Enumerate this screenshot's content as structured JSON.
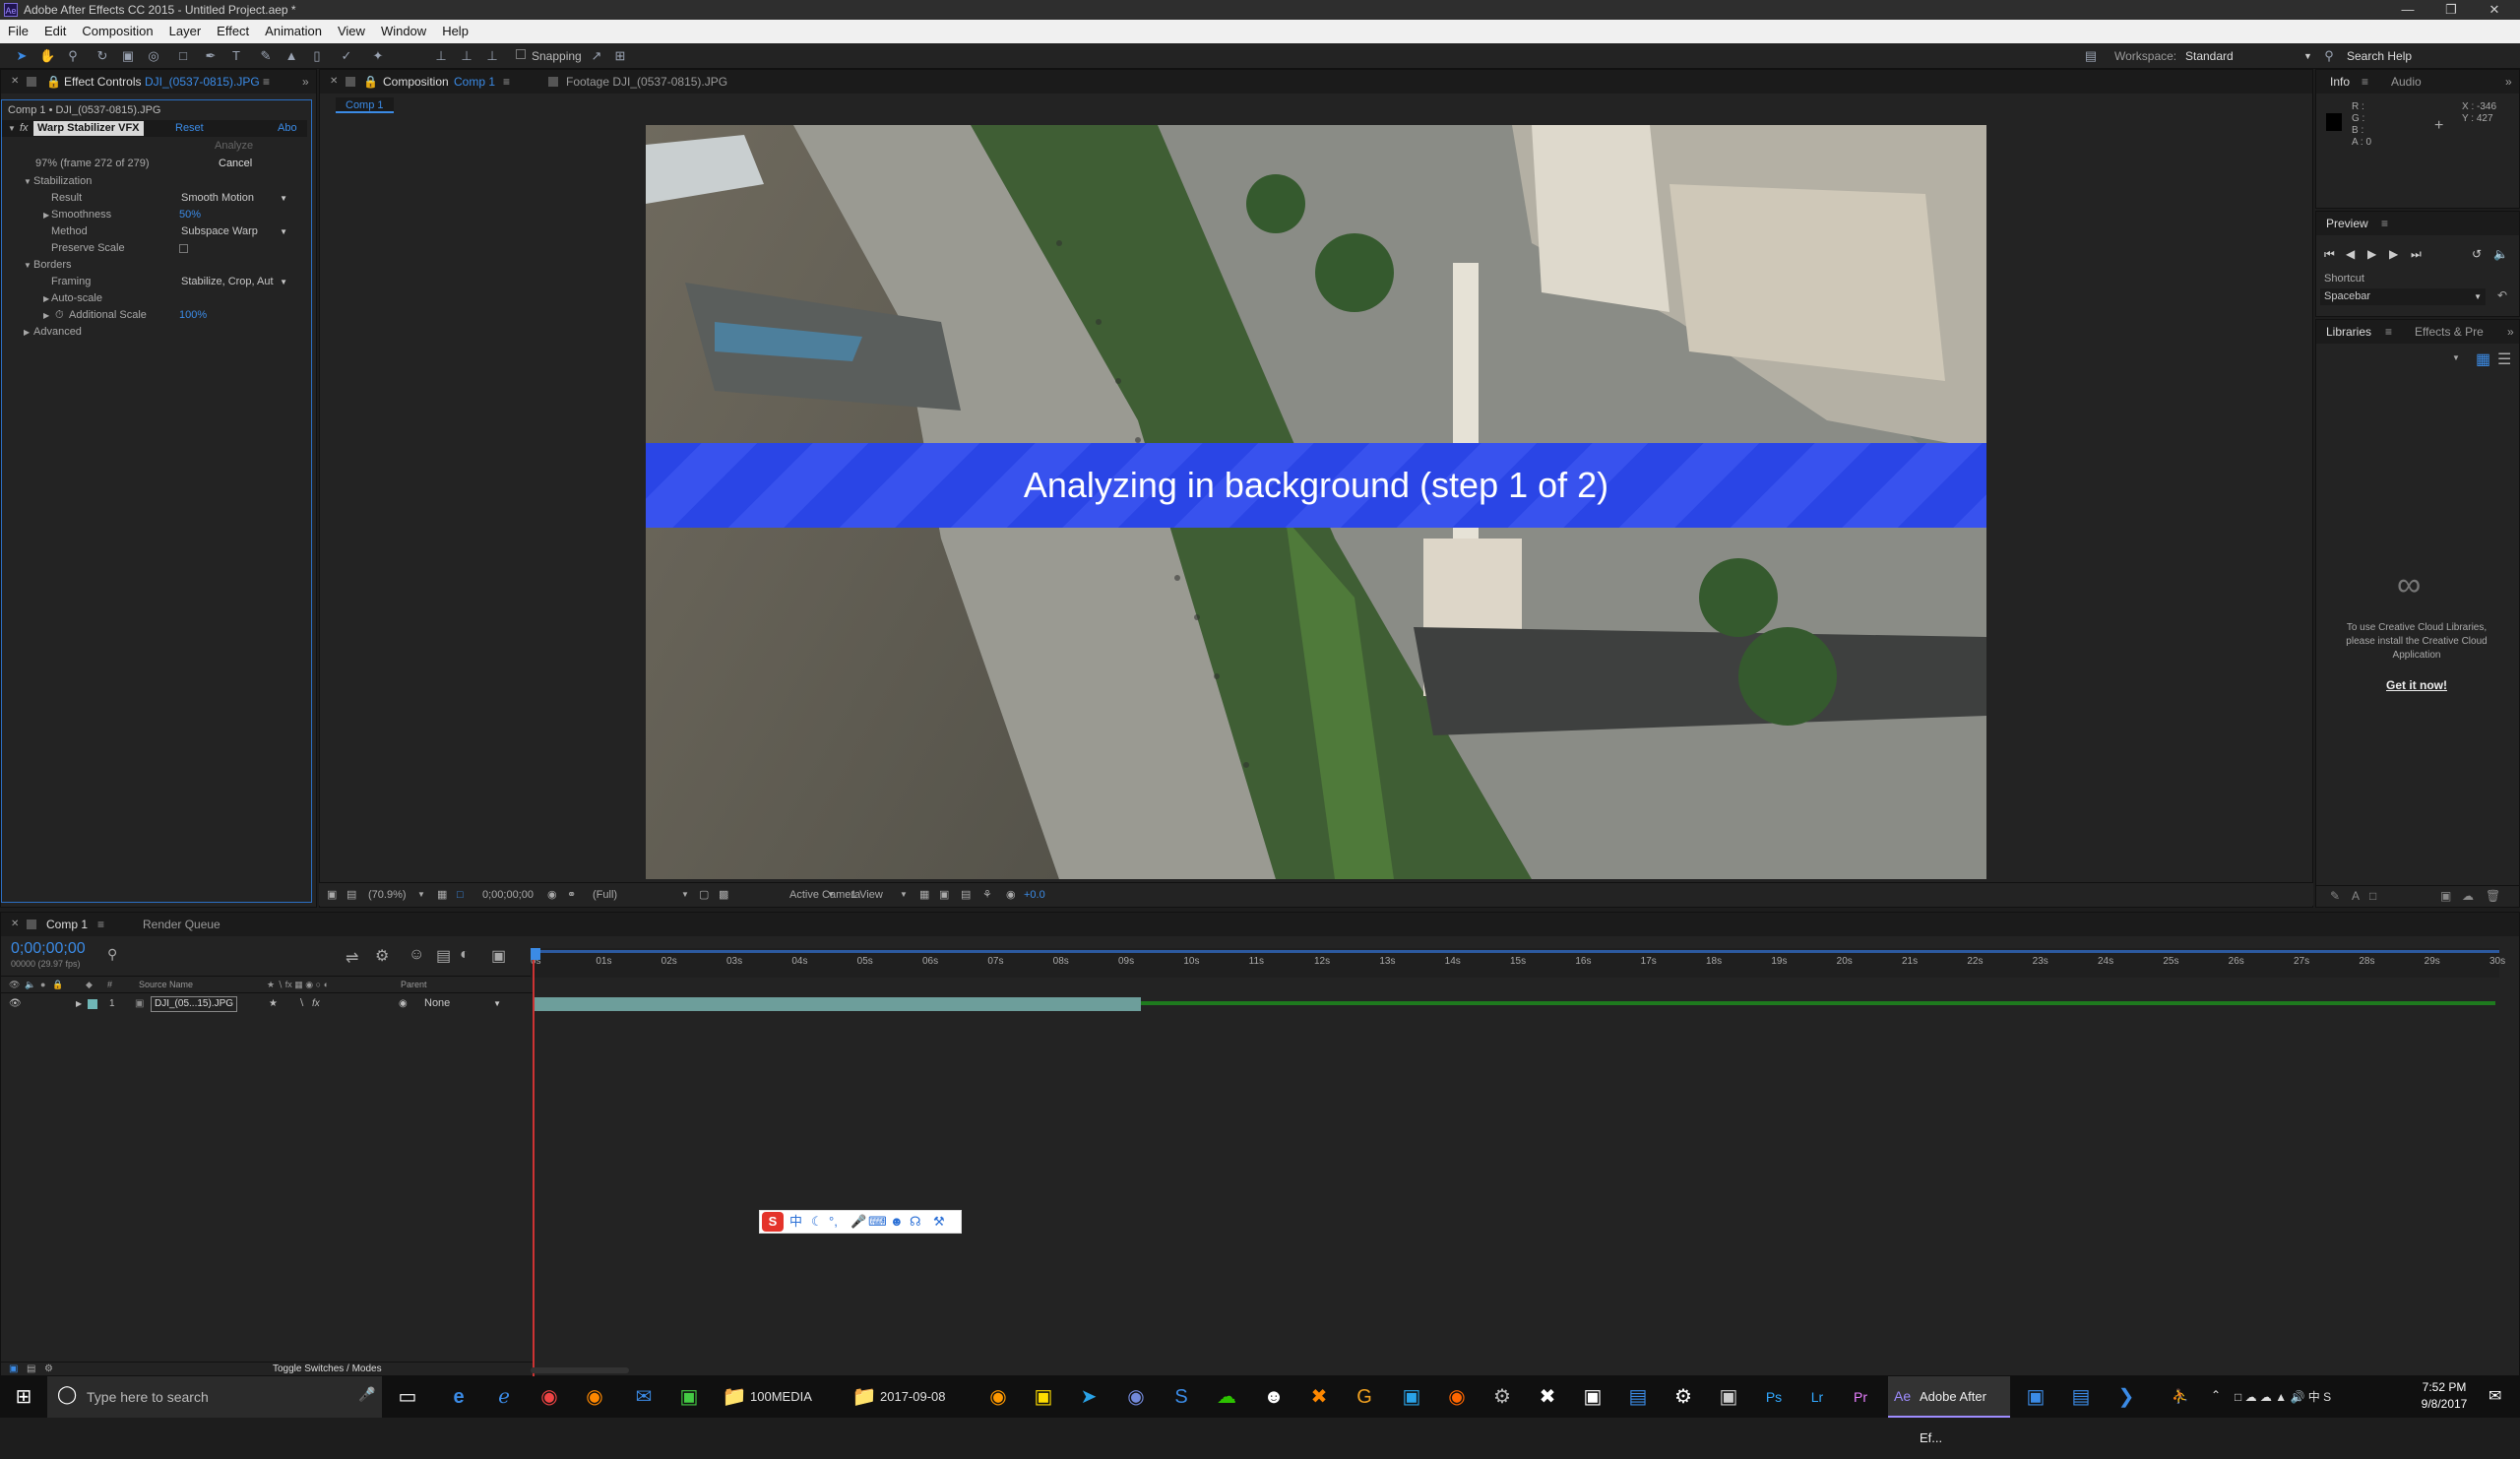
{
  "window": {
    "title": "Adobe After Effects CC 2015 - Untitled Project.aep *",
    "app_icon": "Ae"
  },
  "menu": [
    "File",
    "Edit",
    "Composition",
    "Layer",
    "Effect",
    "Animation",
    "View",
    "Window",
    "Help"
  ],
  "toolbar": {
    "snapping_label": "Snapping",
    "workspace_label": "Workspace:",
    "workspace_value": "Standard",
    "search_placeholder": "Search Help"
  },
  "effect_controls": {
    "tab_label": "Effect Controls",
    "tab_file": "DJI_(0537-0815).JPG",
    "path": "Comp 1 • DJI_(0537-0815).JPG",
    "effect_name": "Warp Stabilizer VFX",
    "reset": "Reset",
    "about": "Abo",
    "analyze": "Analyze",
    "progress": "97% (frame 272 of 279)",
    "cancel": "Cancel",
    "stabilization": "Stabilization",
    "result_label": "Result",
    "result_value": "Smooth Motion",
    "smoothness_label": "Smoothness",
    "smoothness_value": "50%",
    "method_label": "Method",
    "method_value": "Subspace Warp",
    "preserve_label": "Preserve Scale",
    "borders": "Borders",
    "framing_label": "Framing",
    "framing_value": "Stabilize, Crop, Aut",
    "autoscale": "Auto-scale",
    "addscale_label": "Additional Scale",
    "addscale_value": "100%",
    "advanced": "Advanced"
  },
  "composition": {
    "tab_label": "Composition",
    "tab_comp": "Comp 1",
    "footage_tab": "Footage DJI_(0537-0815).JPG",
    "sub_tab": "Comp 1",
    "banner": "Analyzing in background (step 1 of 2)",
    "zoom": "(70.9%)",
    "timecode": "0;00;00;00",
    "resolution": "(Full)",
    "camera": "Active Camera",
    "view": "1 View",
    "exposure": "+0.0"
  },
  "info_panel": {
    "tab": "Info",
    "tab2": "Audio",
    "r": "R :",
    "g": "G :",
    "b": "B :",
    "a": "A : 0",
    "x": "X : -346",
    "y": "Y : 427"
  },
  "preview_panel": {
    "tab": "Preview",
    "shortcut_label": "Shortcut",
    "shortcut_value": "Spacebar"
  },
  "libraries_panel": {
    "tab": "Libraries",
    "tab2": "Effects & Pre",
    "message": "To use Creative Cloud Libraries, please install the Creative Cloud Application",
    "link": "Get it now!"
  },
  "timeline": {
    "tab": "Comp 1",
    "tab2": "Render Queue",
    "timecode": "0;00;00;00",
    "fps": "00000 (29.97 fps)",
    "col_source": "Source Name",
    "col_parent": "Parent",
    "layer_num": "1",
    "layer_name": "DJI_(05...15).JPG",
    "parent_value": "None",
    "ticks": [
      "0s",
      "01s",
      "02s",
      "03s",
      "04s",
      "05s",
      "06s",
      "07s",
      "08s",
      "09s",
      "10s",
      "11s",
      "12s",
      "13s",
      "14s",
      "15s",
      "16s",
      "17s",
      "18s",
      "19s",
      "20s",
      "21s",
      "22s",
      "23s",
      "24s",
      "25s",
      "26s",
      "27s",
      "28s",
      "29s",
      "30s"
    ],
    "toggle_label": "Toggle Switches / Modes"
  },
  "taskbar": {
    "search": "Type here to search",
    "item_100media": "100MEDIA",
    "item_date": "2017-09-08",
    "item_ae": "Adobe After Ef...",
    "time": "7:52 PM",
    "date": "9/8/2017"
  },
  "colors": {
    "accent": "#3b8be6",
    "banner": "#2a45e6",
    "bg": "#232323"
  }
}
